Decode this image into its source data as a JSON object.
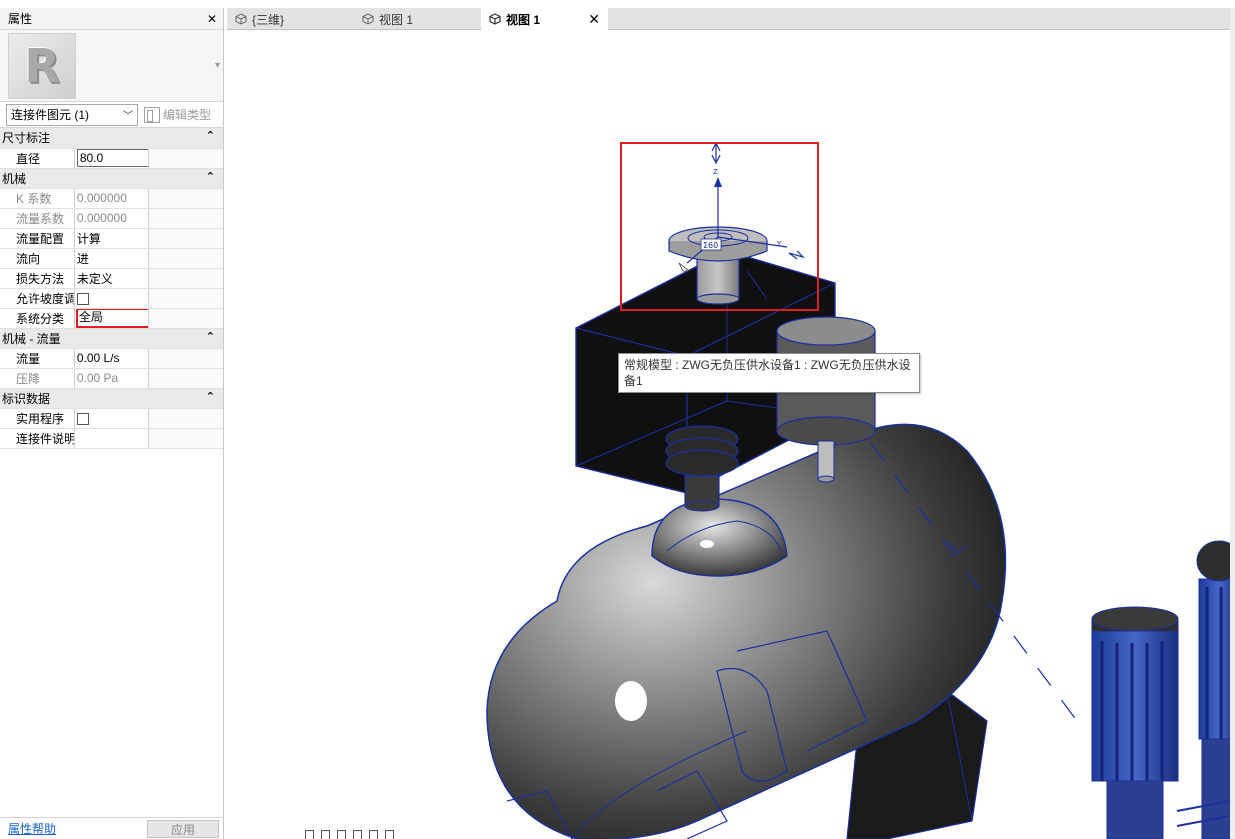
{
  "properties": {
    "title": "属性",
    "element_selector": "连接件图元 (1)",
    "edit_type_label": "编辑类型",
    "categories": [
      {
        "name": "尺寸标注",
        "rows": [
          {
            "name": "直径",
            "value": "80.0"
          }
        ]
      },
      {
        "name": "机械",
        "rows": [
          {
            "name": "K 系数",
            "value": "0.000000"
          },
          {
            "name": "流量系数",
            "value": "0.000000"
          },
          {
            "name": "流量配置",
            "value": "计算"
          },
          {
            "name": "流向",
            "value": "进"
          },
          {
            "name": "损失方法",
            "value": "未定义"
          },
          {
            "name": "允许坡度调整",
            "value": ""
          },
          {
            "name": "系统分类",
            "value": "全局"
          }
        ]
      },
      {
        "name": "机械 - 流量",
        "rows": [
          {
            "name": "流量",
            "value": "0.00 L/s"
          },
          {
            "name": "压降",
            "value": "0.00 Pa"
          }
        ]
      },
      {
        "name": "标识数据",
        "rows": [
          {
            "name": "实用程序",
            "value": ""
          },
          {
            "name": "连接件说明",
            "value": ""
          }
        ]
      }
    ],
    "help_link": "属性帮助",
    "apply_button": "应用"
  },
  "tabs": [
    {
      "label": "{三维}"
    },
    {
      "label": "视图 1"
    },
    {
      "label": "视图 1"
    }
  ],
  "viewport": {
    "tooltip": "常规模型 : ZWG无负压供水设备1 : ZWG无负压供水设备1",
    "axis_z": "Z",
    "axis_y": "Y"
  },
  "colors": {
    "wire": "#1b2f9e",
    "highlight": "#e0201f",
    "link": "#1a63c7"
  }
}
